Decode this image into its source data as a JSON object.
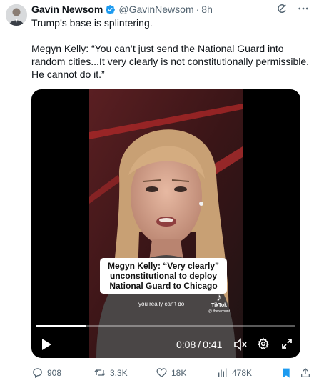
{
  "author": {
    "name": "Gavin Newsom",
    "handle": "@GavinNewsom",
    "separator": "·",
    "time": "8h"
  },
  "text": {
    "line1": "Trump’s base is splintering.",
    "line2": "Megyn Kelly: “You can’t just send the National Guard into random cities...It very clearly is not constitutionally permissible. He cannot do it.”"
  },
  "video": {
    "caption": "Megyn Kelly: “Very clearly” unconstitutional to deploy National Guard to Chicago",
    "subtitle": "you really can't do",
    "watermark_brand": "TikTok",
    "watermark_handle": "@ therecount",
    "time_current": "0:08",
    "time_separator": "/",
    "time_total": "0:41",
    "progress": 0.195
  },
  "actions": {
    "replies": "908",
    "reposts": "3.3K",
    "likes": "18K",
    "views": "478K"
  },
  "colors": {
    "text_primary": "#0f1419",
    "text_secondary": "#536471",
    "brand_blue": "#1d9bf0",
    "verified_blue": "#1d9bf0"
  },
  "icons": {
    "verified": "verified-badge-icon",
    "grok": "grok-icon",
    "more": "more-icon",
    "play": "play-icon",
    "mute": "mute-icon",
    "settings": "gear-icon",
    "fullscreen": "fullscreen-icon",
    "reply": "reply-icon",
    "repost": "repost-icon",
    "like": "heart-icon",
    "views": "views-icon",
    "bookmark": "bookmark-icon",
    "share": "share-icon"
  }
}
